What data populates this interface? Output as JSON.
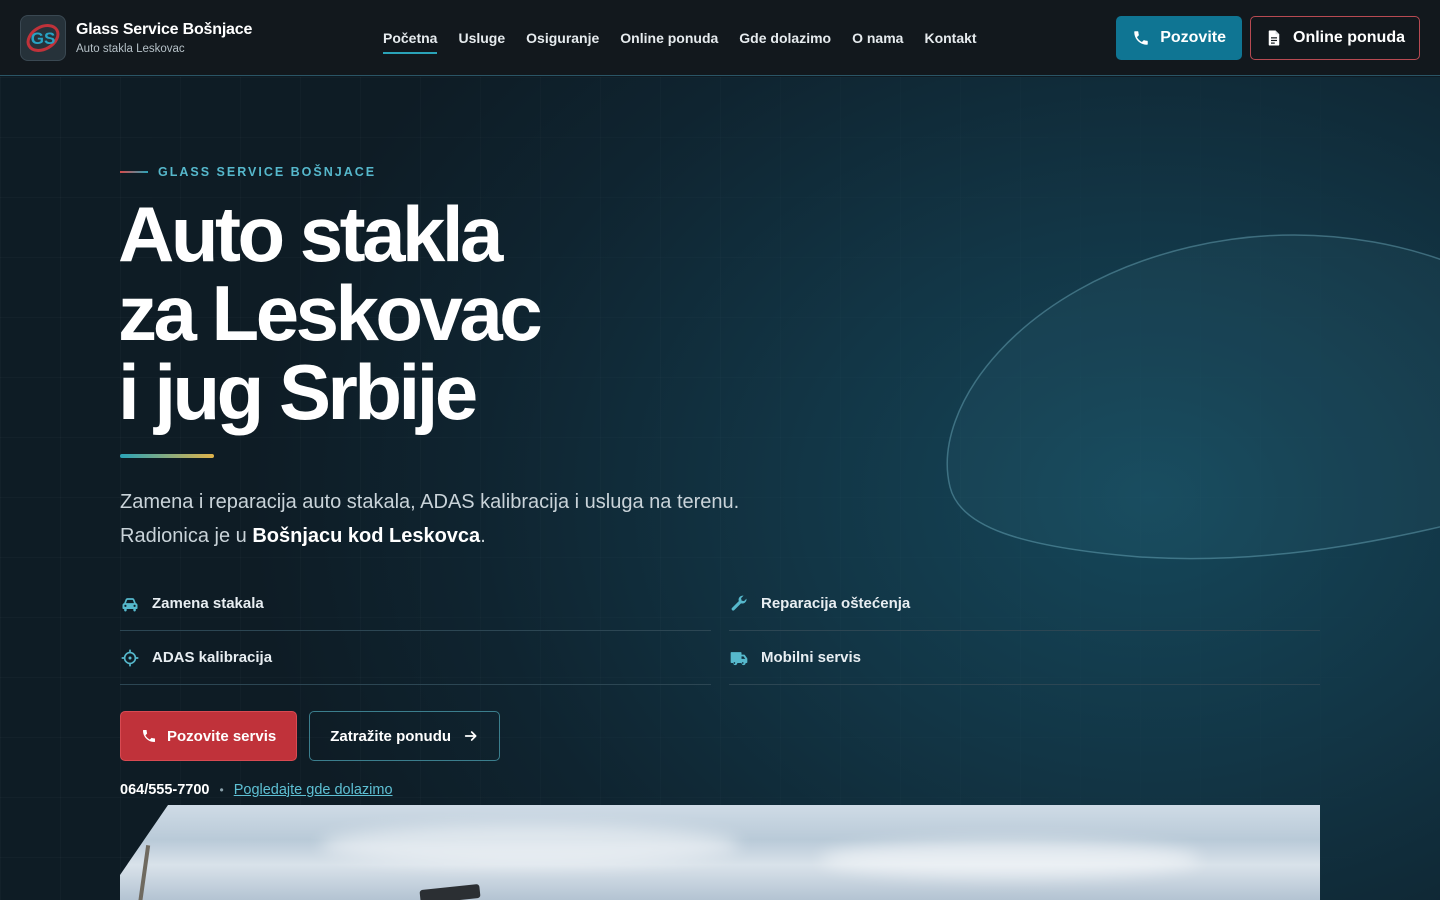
{
  "brand": {
    "logo_text": "GS",
    "title": "Glass Service Bošnjace",
    "subtitle": "Auto stakla Leskovac"
  },
  "nav": {
    "items": [
      {
        "label": "Početna",
        "active": true
      },
      {
        "label": "Usluge"
      },
      {
        "label": "Osiguranje"
      },
      {
        "label": "Online ponuda"
      },
      {
        "label": "Gde dolazimo"
      },
      {
        "label": "O nama"
      },
      {
        "label": "Kontakt"
      }
    ]
  },
  "header_actions": {
    "call_label": "Pozovite",
    "call_icon": "phone-icon",
    "offer_label": "Online ponuda",
    "offer_icon": "document-icon"
  },
  "hero": {
    "eyebrow": "GLASS SERVICE BOŠNJACE",
    "headline": [
      "Auto stakla",
      "za Leskovac",
      "i jug Srbije"
    ],
    "lead_1": "Zamena i reparacija auto stakala, ADAS kalibracija i usluga na terenu.",
    "lead_2_prefix": "Radionica je u ",
    "lead_2_strong": "Bošnjacu kod Leskovca",
    "lead_2_suffix": ".",
    "features": [
      {
        "label": "Zamena stakala",
        "icon": "car-icon"
      },
      {
        "label": "Reparacija oštećenja",
        "icon": "wrench-icon"
      },
      {
        "label": "ADAS kalibracija",
        "icon": "crosshair-icon"
      },
      {
        "label": "Mobilni servis",
        "icon": "truck-icon"
      }
    ],
    "cta_primary": "Pozovite servis",
    "cta_secondary": "Zatražite ponudu",
    "phone": "064/555-7700",
    "separator": "•",
    "location_link": "Pogledajte gde dolazimo"
  },
  "colors": {
    "accent_teal": "#0f7593",
    "accent_red": "#c0323a",
    "header_bg": "#12181d",
    "hero_bg": "#0f2430"
  }
}
